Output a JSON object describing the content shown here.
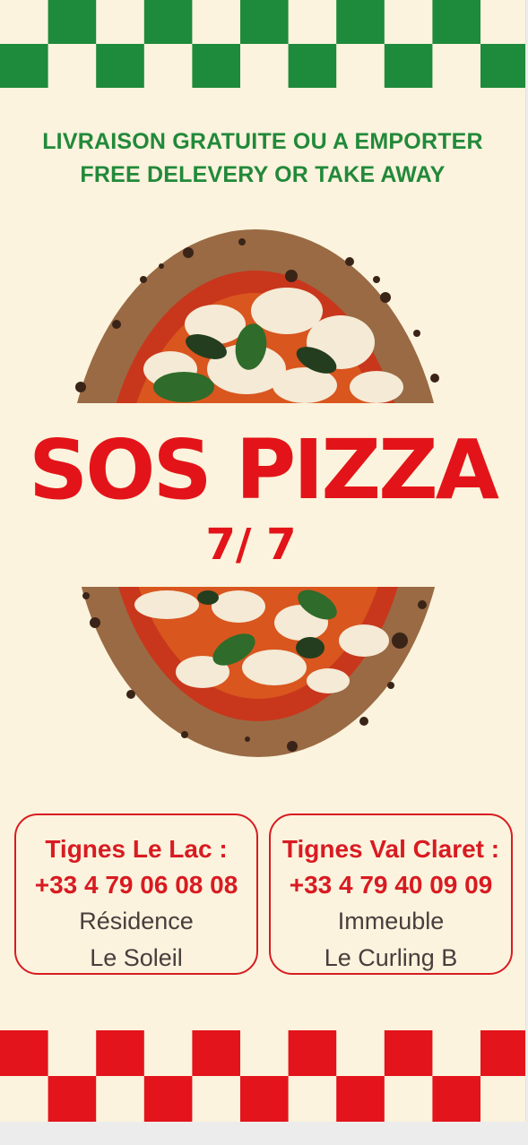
{
  "tagline": {
    "line1": "LIVRAISON GRATUITE OU A EMPORTER",
    "line2": "FREE DELEVERY OR TAKE AWAY"
  },
  "title": "SOS PIZZA",
  "subtitle": "7/ 7",
  "locations": [
    {
      "name": "Tignes Le Lac :",
      "phone": "+33 4 79 06 08 08",
      "address_line1": "Résidence",
      "address_line2": "Le Soleil"
    },
    {
      "name": "Tignes Val Claret :",
      "phone": "+33 4 79 40 09 09",
      "address_line1": "Immeuble",
      "address_line2": "Le Curling B"
    }
  ],
  "colors": {
    "background": "#fbf3dd",
    "green": "#22893a",
    "red": "#e31419"
  },
  "icons": {
    "top_banner": "green-checker-pattern",
    "bottom_banner": "red-checker-pattern",
    "pizza": "margherita-pizza-image"
  }
}
